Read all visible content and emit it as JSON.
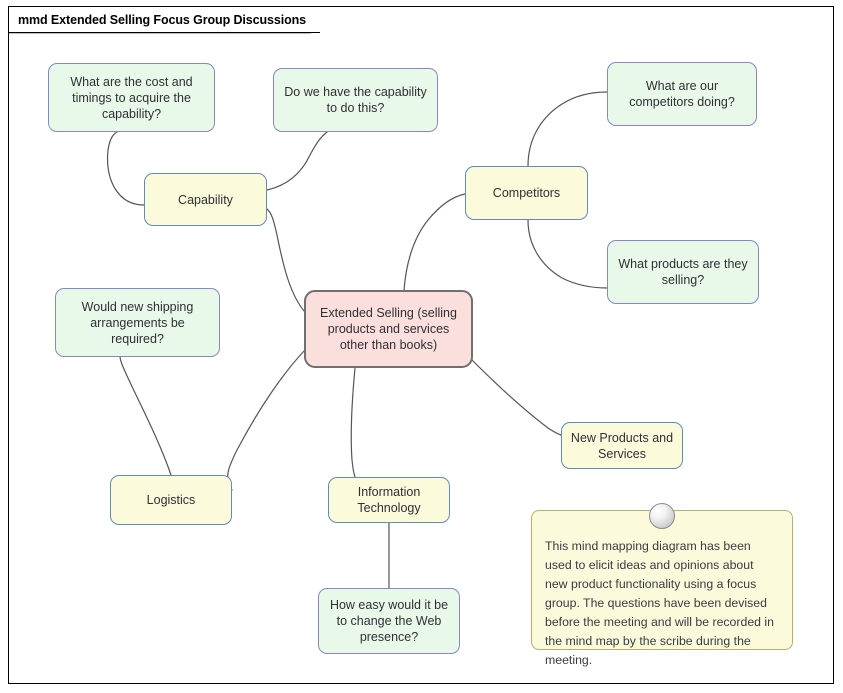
{
  "frame": {
    "title": "mmd Extended Selling Focus Group Discussions"
  },
  "diagram": {
    "type": "mind-map",
    "center": {
      "label": "Extended Selling (selling products and services other than books)",
      "fill": "#fbdfdc",
      "stroke": "#707070"
    },
    "branches": [
      {
        "id": "capability",
        "label": "Capability",
        "fill": "#fbfbdc",
        "stroke": "#5f8db8"
      },
      {
        "id": "competitors",
        "label": "Competitors",
        "fill": "#fbfbdc",
        "stroke": "#5f8db8"
      },
      {
        "id": "logistics",
        "label": "Logistics",
        "fill": "#fbfbdc",
        "stroke": "#5f8db8"
      },
      {
        "id": "information-technology",
        "label": "Information Technology",
        "fill": "#fbfbdc",
        "stroke": "#5f8db8"
      },
      {
        "id": "new-products",
        "label": "New Products and Services",
        "fill": "#fbfbdc",
        "stroke": "#5f8db8"
      }
    ],
    "questions": [
      {
        "id": "cost-timings",
        "label": "What are the cost and timings to acquire the capability?",
        "parent": "capability",
        "fill": "#e9f9e9",
        "stroke": "#8787c8"
      },
      {
        "id": "have-capability",
        "label": "Do we have the capability to do this?",
        "parent": "capability",
        "fill": "#e9f9e9",
        "stroke": "#8787c8"
      },
      {
        "id": "competitors-doing",
        "label": "What are our competitors doing?",
        "parent": "competitors",
        "fill": "#e9f9e9",
        "stroke": "#8787c8"
      },
      {
        "id": "products-selling",
        "label": "What products are they selling?",
        "parent": "competitors",
        "fill": "#e9f9e9",
        "stroke": "#8787c8"
      },
      {
        "id": "shipping-arrangements",
        "label": "Would new shipping arrangements be required?",
        "parent": "logistics",
        "fill": "#e9f9e9",
        "stroke": "#8787c8"
      },
      {
        "id": "web-presence",
        "label": "How easy would it be to change the Web presence?",
        "parent": "information-technology",
        "fill": "#e9f9e9",
        "stroke": "#8787c8"
      }
    ],
    "note": {
      "text": "This mind mapping diagram has been used to elicit ideas and opinions about new product functionality using a focus group. The questions have been devised before the meeting and will be recorded in the mind map by the scribe during the meeting.",
      "fill": "#fbfbdc",
      "stroke": "#b9ad6d"
    },
    "connector_color": "#555555"
  }
}
